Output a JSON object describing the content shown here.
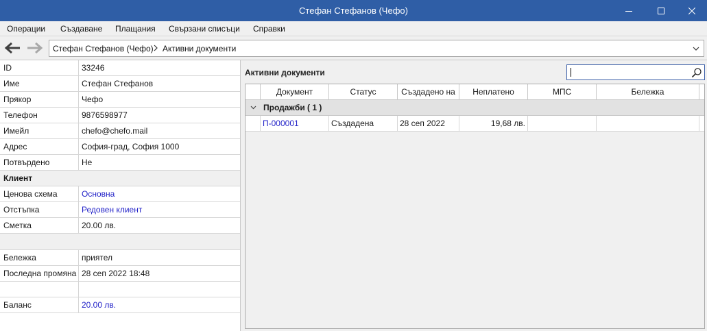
{
  "window": {
    "title": "Стефан Стефанов (Чефо)"
  },
  "menu": [
    "Операции",
    "Създаване",
    "Плащания",
    "Свързани списъци",
    "Справки"
  ],
  "breadcrumb": {
    "parent": "Стефан Стефанов (Чефо)",
    "current": "Активни документи"
  },
  "properties": [
    {
      "key": "ID",
      "value": "33246"
    },
    {
      "key": "Име",
      "value": "Стефан Стефанов"
    },
    {
      "key": "Прякор",
      "value": "Чефо"
    },
    {
      "key": "Телефон",
      "value": "9876598977"
    },
    {
      "key": "Имейл",
      "value": "chefo@chefo.mail"
    },
    {
      "key": "Адрес",
      "value": "София-град, София 1000"
    },
    {
      "key": "Потвърдено",
      "value": "Не"
    },
    {
      "section": "Клиент"
    },
    {
      "key": "Ценова схема",
      "value": "Основна",
      "link": true
    },
    {
      "key": "Отстъпка",
      "value": "Редовен клиент",
      "link": true
    },
    {
      "key": "Сметка",
      "value": "20.00 лв."
    },
    {
      "section": ""
    },
    {
      "key": "Бележка",
      "value": "приятел"
    },
    {
      "key": "Последна промяна",
      "value": "28 сеп 2022 18:48"
    },
    {
      "key": "",
      "value": ""
    },
    {
      "key": "Баланс",
      "value": "20.00 лв.",
      "link": true
    }
  ],
  "documents": {
    "title": "Активни документи",
    "search_value": "",
    "columns": [
      "Документ",
      "Статус",
      "Създадено на",
      "Неплатено",
      "МПС",
      "Бележка"
    ],
    "group_label": "Продажби ( 1 )",
    "rows": [
      {
        "document": "П-000001",
        "status": "Създадена",
        "created": "28 сеп 2022",
        "unpaid": "19,68 лв.",
        "vehicle": "",
        "note": ""
      }
    ]
  },
  "colors": {
    "titlebar": "#2f5ea6",
    "link": "#2323c8",
    "search_border": "#3b5fa8"
  }
}
